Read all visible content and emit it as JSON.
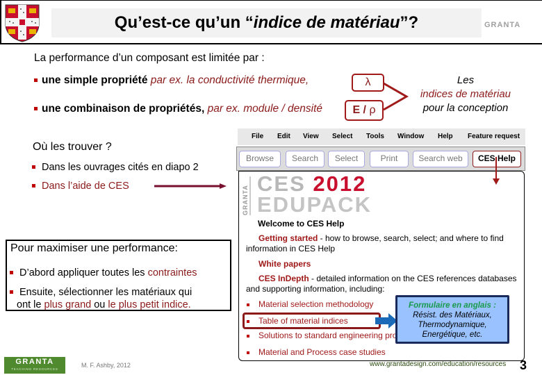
{
  "header": {
    "title_prefix": "Qu’est-ce qu’un “",
    "title_italic": "indice de matériau",
    "title_suffix": "”?",
    "brand": "GRANTA"
  },
  "intro": {
    "heading": "La performance d’un composant est limitée par :",
    "bullets": [
      {
        "bold": "une simple propriété",
        "example": " par ex. la conductivité thermique,"
      },
      {
        "bold": "une combinaison de propriétés,",
        "example": " par ex. module / densité"
      }
    ],
    "symbols": {
      "single": "λ",
      "combo_E": "E / ",
      "combo_rho": "ρ"
    },
    "callout": {
      "line1": "Les",
      "line2": "indices de matériau",
      "line3": "pour la conception"
    }
  },
  "where": {
    "heading": "Où les trouver ?",
    "items": [
      "Dans les ouvrages cités en diapo 2",
      "Dans l’aide de CES"
    ]
  },
  "ces_window": {
    "menu": [
      "File",
      "Edit",
      "View",
      "Select",
      "Tools",
      "Window",
      "Help",
      "Feature request"
    ],
    "toolbar": [
      "Browse",
      "Search",
      "Select",
      "Print",
      "Search web",
      "CES Help"
    ],
    "logo": {
      "ces": "CES",
      "year": "2012",
      "edupack": "EDUPACK",
      "vertical": "GRANTA"
    },
    "welcome": "Welcome to CES Help",
    "sections": [
      {
        "link": "Getting started",
        "text": " - how to browse, search, select; and where to find information in CES Help"
      },
      {
        "link": "White papers",
        "text": ""
      },
      {
        "link": "CES InDepth",
        "text": " - detailed information on the CES references databases and supporting information, including:"
      }
    ],
    "list": [
      "Material selection methodology",
      "Table of material indices",
      "Solutions to standard engineering problems",
      "Material and Process case studies"
    ]
  },
  "formulaire": {
    "heading": "Formulaire en anglais :",
    "lines": [
      "Résist. des Matériaux,",
      "Thermodynamique,",
      "Energétique, etc."
    ]
  },
  "maximise": {
    "heading": "Pour maximiser une performance:",
    "item1_text": "D’abord appliquer toutes les ",
    "item1_red": "contraintes",
    "item2_line1": "Ensuite, sélectionner les matériaux qui",
    "item2_pre": "ont le ",
    "item2_red1": "plus grand",
    "item2_mid": " ou ",
    "item2_red2": "le plus petit indice",
    "item2_end": "."
  },
  "footer": {
    "brand": "GRANTA",
    "brand_sub": "TEACHING RESOURCES",
    "author": "M. F. Ashby, 2012",
    "url": "www.grantadesign.com/education/resources",
    "page": "3"
  },
  "colors": {
    "accent_red": "#8b1a1a",
    "granta_green": "#4f8a2e",
    "formulaire_bg": "#99c2ff",
    "formulaire_heading": "#1a9a4a"
  }
}
